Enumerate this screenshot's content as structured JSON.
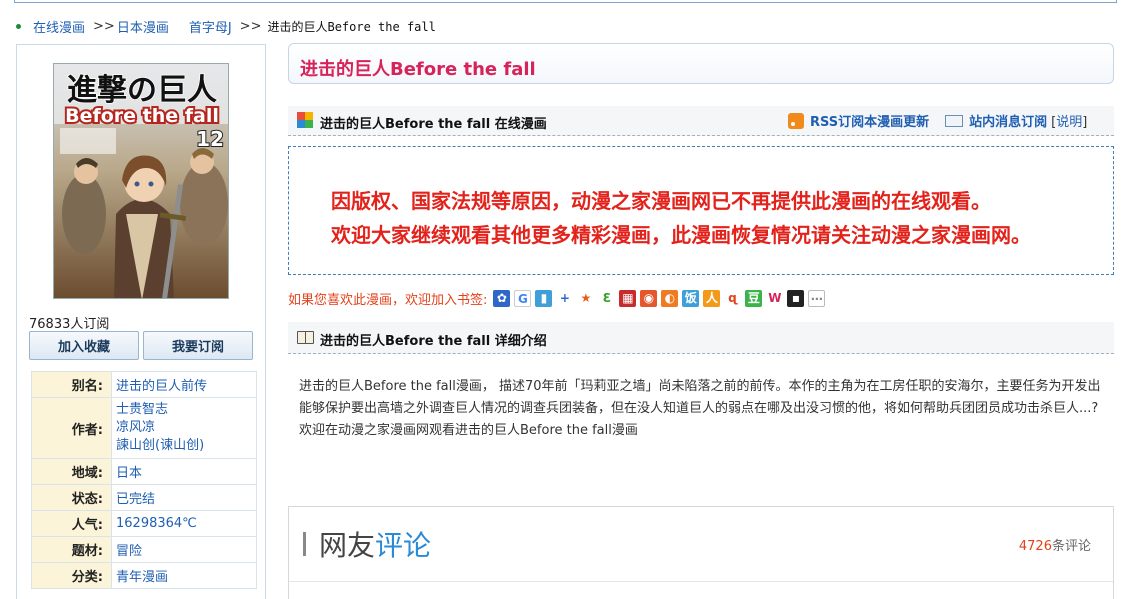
{
  "breadcrumb": {
    "items": [
      "在线漫画",
      "日本漫画",
      "首字母J"
    ],
    "separator": ">>",
    "current": "进击的巨人Before the fall"
  },
  "sidebar": {
    "subscribers": "76833人订阅",
    "add_favorite": "加入收藏",
    "subscribe": "我要订阅",
    "info": [
      {
        "label": "别名:",
        "values": [
          "进击的巨人前传"
        ]
      },
      {
        "label": "作者:",
        "values": [
          "士贵智志",
          "凉风凉",
          "諫山创(谏山创)"
        ]
      },
      {
        "label": "地域:",
        "values": [
          "日本"
        ]
      },
      {
        "label": "状态:",
        "values": [
          "已完结"
        ]
      },
      {
        "label": "人气:",
        "values": [
          "16298364℃"
        ]
      },
      {
        "label": "题材:",
        "values": [
          "冒险"
        ]
      },
      {
        "label": "分类:",
        "values": [
          "青年漫画"
        ]
      }
    ]
  },
  "main": {
    "title": "进击的巨人Before the fall",
    "online_section_title": "进击的巨人Before the fall 在线漫画",
    "rss_label": "RSS订阅本漫画更新",
    "site_msg_label": "站内消息订阅",
    "help_label": "说明",
    "help_left": "[",
    "help_right": "]",
    "notice_line1": "因版权、国家法规等原因，动漫之家漫画网已不再提供此漫画的在线观看。",
    "notice_line2": "欢迎大家继续观看其他更多精彩漫画，此漫画恢复情况请关注动漫之家漫画网。",
    "bookmark_prompt": "如果您喜欢此漫画，欢迎加入书签:",
    "detail_section_title": "进击的巨人Before the fall 详细介绍",
    "description": "进击的巨人Before the fall漫画， 描述70年前「玛莉亚之墙」尚未陷落之前的前传。本作的主角为在工房任职的安海尔，主要任务为开发出能够保护要出高墙之外调查巨人情况的调查兵团装备，但在没人知道巨人的弱点在哪及出没习惯的他，将如何帮助兵团团员成功击杀巨人...?",
    "welcome": "欢迎在动漫之家漫画网观看进击的巨人Before the fall漫画"
  },
  "cover": {
    "title_line1": "進撃の巨人",
    "title_line2": "Before the fall",
    "volume": "12"
  },
  "comments": {
    "title_a": "网友",
    "title_b": "评论",
    "count": "4726",
    "count_suffix": "条评论"
  },
  "colors": {
    "title": "#d8235a",
    "notice": "#e3221b",
    "link": "#1f5fb2"
  },
  "bookmark_icons": [
    "baidu-icon",
    "google-icon",
    "bookmark-icon",
    "plus-icon",
    "favorite-icon",
    "3-icon",
    "delicious-icon",
    "qq-icon",
    "vip-icon",
    "fanfou-icon",
    "renren-icon",
    "tianya-icon",
    "douban-icon",
    "w-icon",
    "digg-icon",
    "more-icon"
  ]
}
